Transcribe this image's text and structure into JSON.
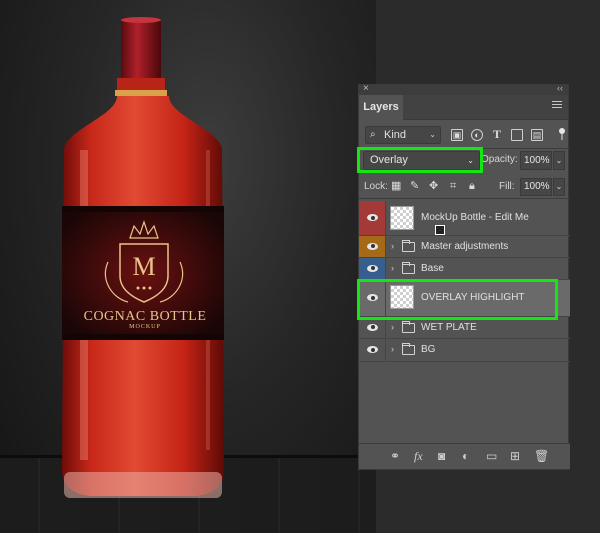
{
  "panel": {
    "close_glyph": "×",
    "collapse_glyph": "‹‹",
    "tab_label": "Layers",
    "menu_icon": "panel-menu-icon",
    "filter": {
      "kind_label": "Kind",
      "kind_icon": "search-icon",
      "filter_icons": [
        "image-icon",
        "adjustment-icon",
        "type-icon",
        "shape-icon",
        "smart-object-icon"
      ]
    },
    "blend_mode": "Overlay",
    "opacity_label": "Opacity:",
    "opacity_value": "100%",
    "lock_label": "Lock:",
    "fill_label": "Fill:",
    "fill_value": "100%",
    "layers": [
      {
        "name": "MockUp Bottle - Edit Me",
        "color_tag": "#a33a37",
        "type": "smart-object"
      },
      {
        "name": "Master adjustments",
        "color_tag": "#a46a18",
        "type": "group"
      },
      {
        "name": "Base",
        "color_tag": "#365f90",
        "type": "group"
      },
      {
        "name": "OVERLAY HIGHLIGHT",
        "color_tag": "",
        "type": "layer",
        "selected": true
      },
      {
        "name": "WET PLATE",
        "color_tag": "",
        "type": "group"
      },
      {
        "name": "BG",
        "color_tag": "",
        "type": "group"
      }
    ],
    "footer_icons": [
      "link-icon",
      "fx-icon",
      "mask-icon",
      "adjustment-layer-icon",
      "new-group-icon",
      "new-layer-icon",
      "trash-icon"
    ],
    "fx_text": "fx"
  },
  "canvas": {
    "label_title": "COGNAC BOTTLE",
    "label_sub": "MOCKUP",
    "monogram": "M",
    "liquid_color": "#c21e12",
    "cap_color": "#8e1018"
  },
  "highlight_color": "#14e614"
}
